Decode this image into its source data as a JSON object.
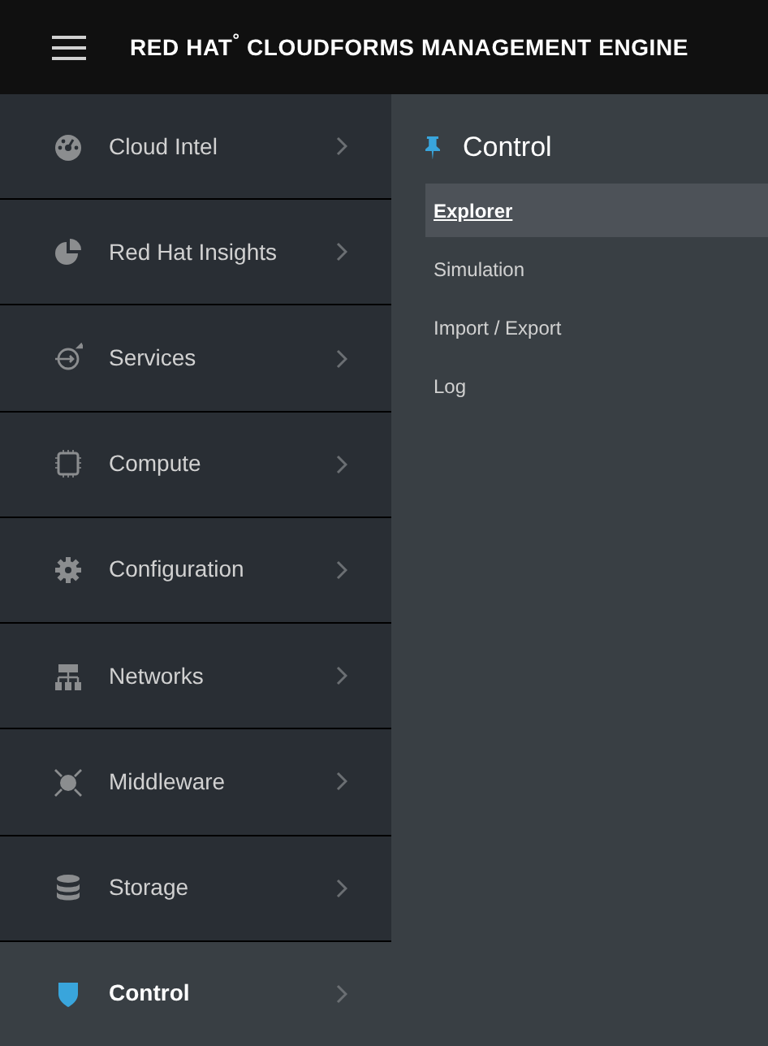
{
  "header": {
    "title": "RED HAT$^{°}$ CLOUDFORMS MANAGEMENT ENGINE"
  },
  "sidebar": {
    "items": [
      {
        "label": "Cloud Intel",
        "selected": false
      },
      {
        "label": "Red Hat Insights",
        "selected": false
      },
      {
        "label": "Services",
        "selected": false
      },
      {
        "label": "Compute",
        "selected": false
      },
      {
        "label": "Configuration",
        "selected": false
      },
      {
        "label": "Networks",
        "selected": false
      },
      {
        "label": "Middleware",
        "selected": false
      },
      {
        "label": "Storage",
        "selected": false
      },
      {
        "label": "Control",
        "selected": true
      }
    ]
  },
  "submenu": {
    "title": "Control",
    "items": [
      {
        "label": "Explorer",
        "selected": true
      },
      {
        "label": "Simulation",
        "selected": false
      },
      {
        "label": "Import / Export",
        "selected": false
      },
      {
        "label": "Log",
        "selected": false
      }
    ]
  }
}
